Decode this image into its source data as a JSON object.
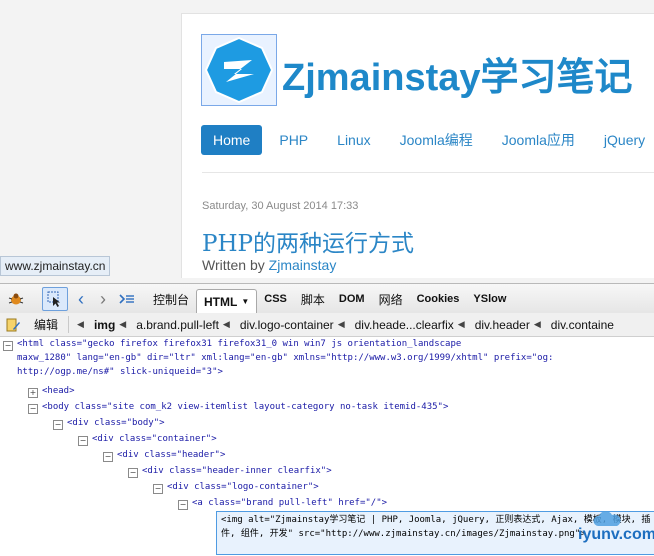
{
  "site": {
    "title": "Zjmainstay学习笔记",
    "nav": [
      "Home",
      "PHP",
      "Linux",
      "Joomla编程",
      "Joomla应用",
      "jQuery"
    ],
    "post_date": "Saturday, 30 August 2014 17:33",
    "post_title": "PHP的两种运行方式",
    "written_by": "Written by",
    "author": "Zjmainstay",
    "status_url": "www.zjmainstay.cn"
  },
  "firebug": {
    "tabs": [
      "控制台",
      "HTML",
      "CSS",
      "脚本",
      "DOM",
      "网络",
      "Cookies",
      "YSlow"
    ],
    "active_tab": "HTML",
    "edit_label": "编辑",
    "breadcrumbs": [
      "img",
      "a.brand.pull-left",
      "div.logo-container",
      "div.heade...clearfix",
      "div.header",
      "div.containe"
    ]
  },
  "tree": {
    "html_line1": "<html class=\"gecko firefox firefox31 firefox31_0 win win7 js orientation_landscape",
    "html_line2": "maxw_1280\" lang=\"en-gb\" dir=\"ltr\" xml:lang=\"en-gb\" xmlns=\"http://www.w3.org/1999/xhtml\" prefix=\"og:",
    "html_line3": "http://ogp.me/ns#\" slick-uniqueid=\"3\">",
    "head": "<head>",
    "body": "<body class=\"site com_k2 view-itemlist layout-category no-task itemid-435\">",
    "div_body": "<div class=\"body\">",
    "div_container": "<div class=\"container\">",
    "div_header": "<div class=\"header\">",
    "div_header_inner": "<div class=\"header-inner clearfix\">",
    "div_logo": "<div class=\"logo-container\">",
    "a_brand": "<a class=\"brand pull-left\" href=\"/\">",
    "img_selected": "<img alt=\"Zjmainstay学习笔记 | PHP, Joomla, jQuery, 正则表达式, Ajax, 模板, 模块, 插件, 组件, 开发\" src=\"http://www.zjmainstay.cn/images/Zjmainstay.png\">"
  },
  "watermark": "iyunv.com",
  "colors": {
    "brand": "#1e88c9",
    "nav_active": "#1f7fc4",
    "selection": "#e8f2fd"
  }
}
